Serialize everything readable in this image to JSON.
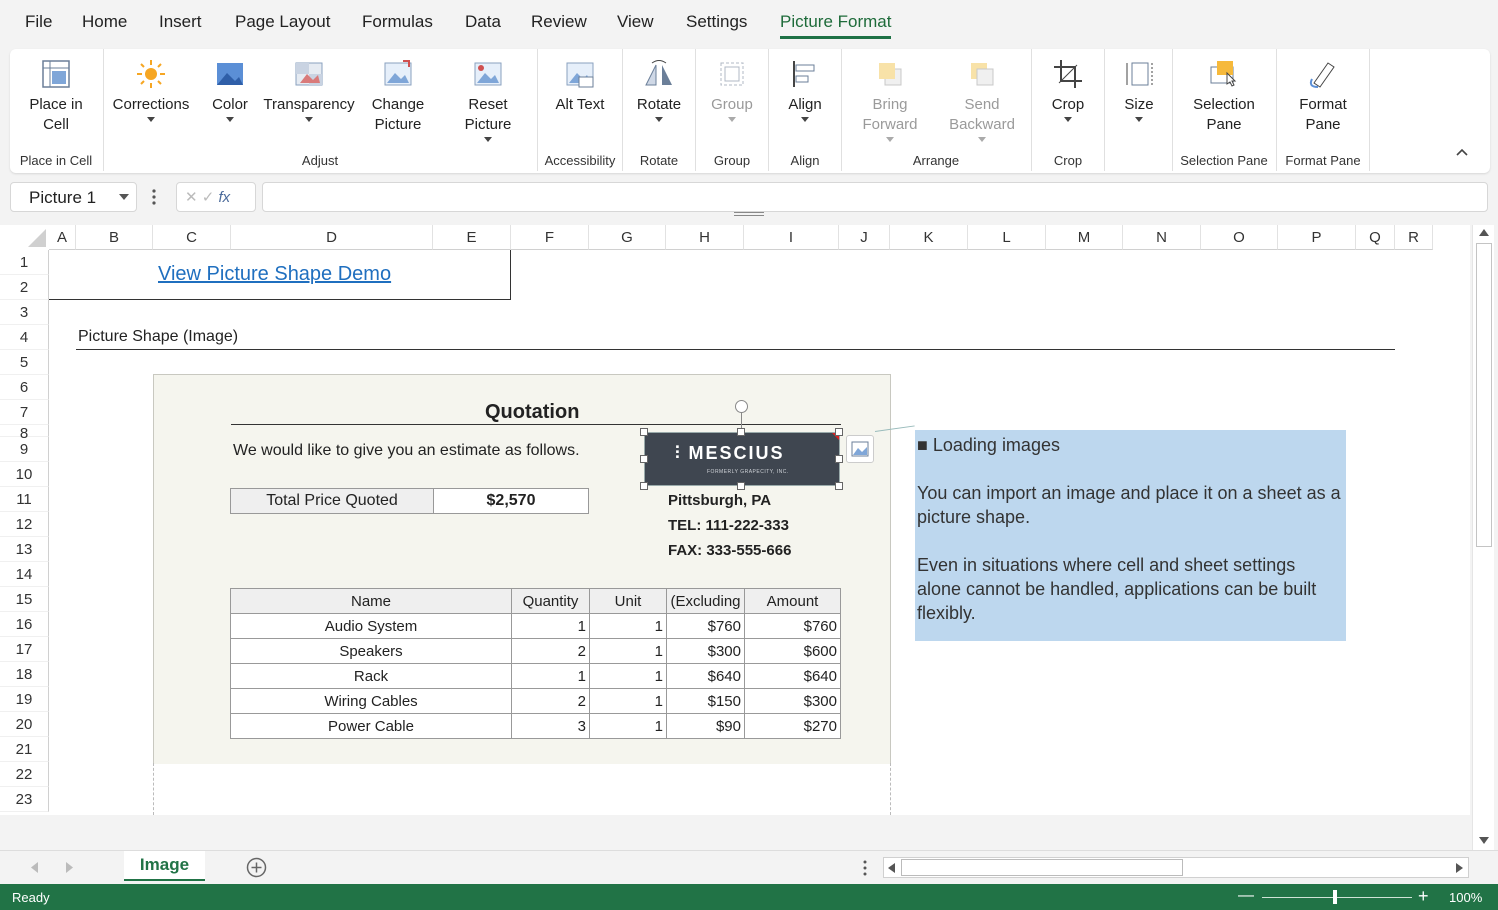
{
  "menu": [
    "File",
    "Home",
    "Insert",
    "Page Layout",
    "Formulas",
    "Data",
    "Review",
    "View",
    "Settings",
    "Picture Format"
  ],
  "ribbon": {
    "buttons": [
      {
        "label": "Place in\nCell",
        "icon": "place-in-cell-icon"
      },
      {
        "label": "Corrections",
        "icon": "sun-icon"
      },
      {
        "label": "Color",
        "icon": "picture-color-icon"
      },
      {
        "label": "Transparency",
        "icon": "transparency-icon"
      },
      {
        "label": "Change\nPicture",
        "icon": "change-picture-icon"
      },
      {
        "label": "Reset\nPicture",
        "icon": "reset-picture-icon"
      },
      {
        "label": "Alt Text",
        "icon": "alt-text-icon"
      },
      {
        "label": "Rotate",
        "icon": "rotate-icon"
      },
      {
        "label": "Group",
        "icon": "group-icon"
      },
      {
        "label": "Align",
        "icon": "align-icon"
      },
      {
        "label": "Bring\nForward",
        "icon": "bring-forward-icon"
      },
      {
        "label": "Send\nBackward",
        "icon": "send-backward-icon"
      },
      {
        "label": "Crop",
        "icon": "crop-icon"
      },
      {
        "label": "Size",
        "icon": "size-icon"
      },
      {
        "label": "Selection\nPane",
        "icon": "selection-pane-icon"
      },
      {
        "label": "Format\nPane",
        "icon": "format-pane-icon"
      }
    ],
    "groups": [
      "Place in Cell",
      "Adjust",
      "Accessibility",
      "Rotate",
      "Group",
      "Align",
      "Arrange",
      "Crop",
      "Selection Pane",
      "Format Pane"
    ]
  },
  "namebox": "Picture 1",
  "fx": "fx",
  "columns": [
    "A",
    "B",
    "C",
    "D",
    "E",
    "F",
    "G",
    "H",
    "I",
    "J",
    "K",
    "L",
    "M",
    "N",
    "O",
    "P",
    "Q",
    "R"
  ],
  "rows": [
    "1",
    "2",
    "3",
    "4",
    "5",
    "6",
    "7",
    "8",
    "9",
    "10",
    "11",
    "12",
    "13",
    "14",
    "15",
    "16",
    "17",
    "18",
    "19",
    "20",
    "21",
    "22",
    "23"
  ],
  "sheet": {
    "link": "View Picture Shape Demo",
    "section_title": "Picture Shape (Image)",
    "quote_title": "Quotation",
    "estimate_text": "We would like to give you an estimate as follows.",
    "total_label": "Total Price Quoted",
    "total_value": "$2,570",
    "logo_text": "MESCIUS",
    "logo_sub": "FORMERLY GRAPECITY, INC.",
    "address": [
      "Pittsburgh, PA",
      "TEL: 111-222-333",
      "FAX: 333-555-666"
    ],
    "table_headers": [
      "Name",
      "Quantity",
      "Unit",
      "(Excluding",
      "Amount"
    ],
    "table_rows": [
      [
        "Audio System",
        "1",
        "1",
        "$760",
        "$760"
      ],
      [
        "Speakers",
        "2",
        "1",
        "$300",
        "$600"
      ],
      [
        "Rack",
        "1",
        "1",
        "$640",
        "$640"
      ],
      [
        "Wiring Cables",
        "2",
        "1",
        "$150",
        "$300"
      ],
      [
        "Power Cable",
        "3",
        "1",
        "$90",
        "$270"
      ]
    ],
    "note": {
      "heading": "■ Loading images",
      "p1": "You can import an image and place it on a sheet as a picture shape.",
      "p2": "Even in situations where cell and sheet settings alone cannot be handled, applications can be built flexibly."
    }
  },
  "tabs": {
    "active": "Image"
  },
  "status": {
    "text": "Ready",
    "zoom": "100%"
  },
  "colors": {
    "accent": "#217346",
    "note_bg": "#bdd7ee",
    "link": "#1f6fbf"
  }
}
